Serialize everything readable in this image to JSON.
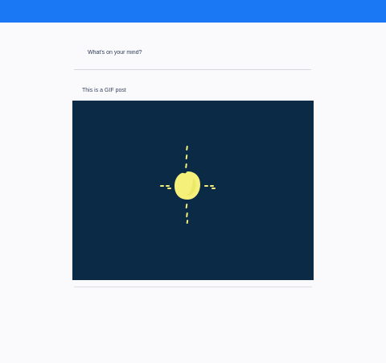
{
  "composer": {
    "placeholder": "What's on your mind?"
  },
  "feed": {
    "posts": [
      {
        "text": "This is a GIF post",
        "media_type": "gif",
        "media_icon": "sun-sparkle-image"
      }
    ]
  },
  "colors": {
    "topbar": "#1a78f5",
    "page_background": "#fafafc",
    "gif_background": "#0b2a45",
    "sun": "#f4f07a"
  }
}
